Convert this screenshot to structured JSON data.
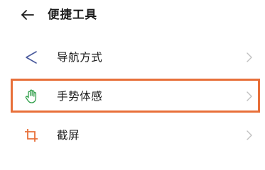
{
  "header": {
    "title": "便捷工具",
    "back_icon": "back-arrow-icon"
  },
  "items": [
    {
      "label": "导航方式",
      "icon": "navigation-triangle-icon",
      "icon_color": "#4a5a9c",
      "chevron": "chevron-right-icon"
    },
    {
      "label": "手势体感",
      "icon": "hand-gesture-icon",
      "icon_color": "#2e9e48",
      "chevron": "chevron-right-icon",
      "highlighted": true
    },
    {
      "label": "截屏",
      "icon": "crop-icon",
      "icon_color": "#e8703a",
      "chevron": "chevron-right-icon"
    }
  ],
  "colors": {
    "highlight_border": "#e8703a",
    "chevron": "#c0c0c0",
    "text": "#1a1a1a",
    "background": "#ffffff"
  }
}
